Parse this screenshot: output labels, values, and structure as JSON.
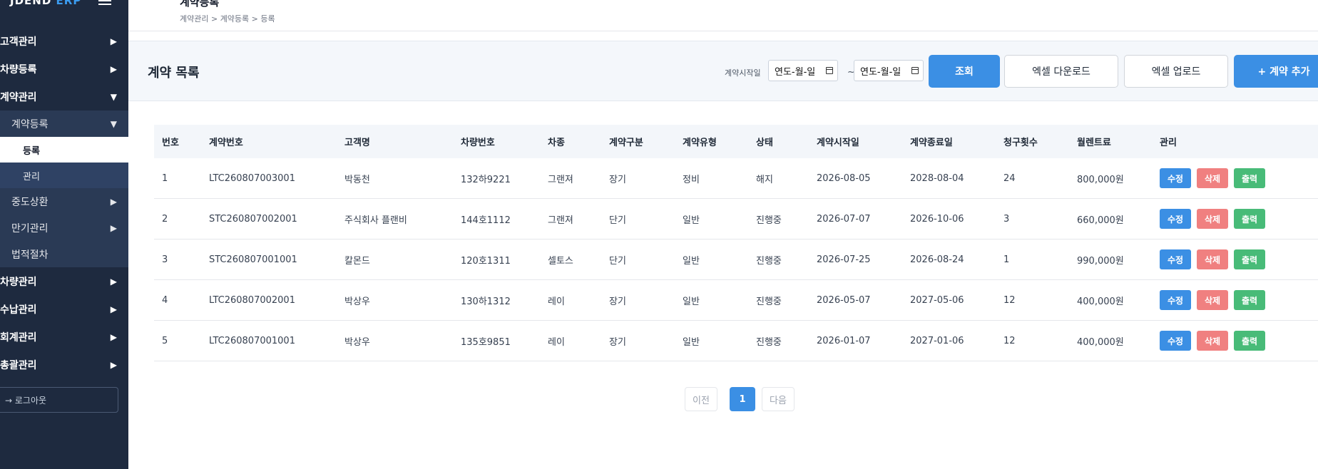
{
  "sidebar": {
    "brand_main": "JDEND",
    "brand_accent": "ERP",
    "menu": {
      "customer": "고객관리",
      "vehicle_reg": "차량등록",
      "contract": "계약관리",
      "contract_reg": "계약등록",
      "register": "등록",
      "manage": "관리",
      "early_return": "중도상환",
      "maturity": "만기관리",
      "legal": "법적절차",
      "vehicle_mgmt": "차량관리",
      "payment": "수납관리",
      "accounting": "회계관리",
      "general": "총괄관리"
    },
    "arrow_right": "▶",
    "arrow_down": "▼",
    "logout": "→ 로그아웃"
  },
  "header": {
    "title": "계약등록",
    "breadcrumb": "계약관리 > 계약등록 > 등록"
  },
  "section": {
    "title": "계약 목록",
    "date_label": "계약시작일",
    "date_placeholder": "연도-월-일",
    "tilde": "~",
    "search_btn": "조회",
    "excel_download": "엑셀 다운로드",
    "excel_upload": "엑셀 업로드",
    "add_btn": "+ 계약 추가"
  },
  "table": {
    "headers": [
      "번호",
      "계약번호",
      "고객명",
      "차량번호",
      "차종",
      "계약구분",
      "계약유형",
      "상태",
      "계약시작일",
      "계약종료일",
      "청구횟수",
      "월렌트료",
      "관리"
    ],
    "rows": [
      [
        "1",
        "LTC260807003001",
        "박동천",
        "132하9221",
        "그랜져",
        "장기",
        "정비",
        "해지",
        "2026-08-05",
        "2028-08-04",
        "24",
        "800,000원"
      ],
      [
        "2",
        "STC260807002001",
        "주식회사 플랜비",
        "144호1112",
        "그랜져",
        "단기",
        "일반",
        "진행중",
        "2026-07-07",
        "2026-10-06",
        "3",
        "660,000원"
      ],
      [
        "3",
        "STC260807001001",
        "칼몬드",
        "120호1311",
        "셀토스",
        "단기",
        "일반",
        "진행중",
        "2026-07-25",
        "2026-08-24",
        "1",
        "990,000원"
      ],
      [
        "4",
        "LTC260807002001",
        "박상우",
        "130하1312",
        "레이",
        "장기",
        "일반",
        "진행중",
        "2026-05-07",
        "2027-05-06",
        "12",
        "400,000원"
      ],
      [
        "5",
        "LTC260807001001",
        "박상우",
        "135호9851",
        "레이",
        "장기",
        "일반",
        "진행중",
        "2026-01-07",
        "2027-01-06",
        "12",
        "400,000원"
      ]
    ],
    "actions": {
      "edit": "수정",
      "delete": "삭제",
      "print": "출력"
    }
  },
  "pagination": {
    "prev": "이전",
    "current": "1",
    "next": "다음"
  }
}
